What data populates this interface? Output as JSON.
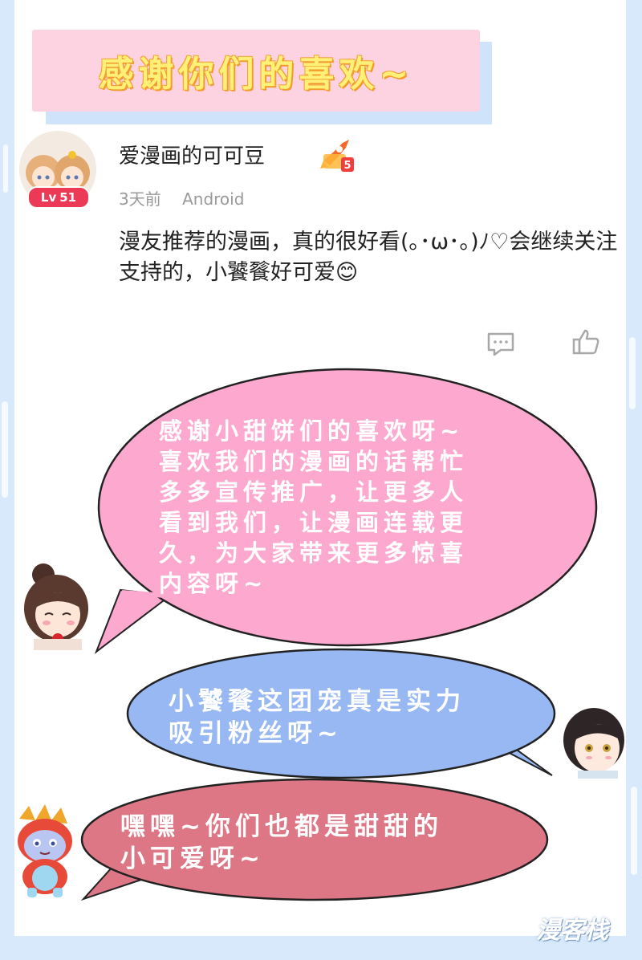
{
  "banner": {
    "text": "感谢你们的喜欢~"
  },
  "comment": {
    "username": "爱漫画的可可豆",
    "level_prefix": "Lv",
    "level": "51",
    "badge_count": "5",
    "time": "3天前",
    "device": "Android",
    "text": "漫友推荐的漫画，真的很好看(｡･ω･｡)ﾉ♡会继续关注支持的，小饕餮好可爱😊"
  },
  "bubbles": {
    "pink": [
      "感谢小甜饼们的喜欢呀~",
      "喜欢我们的漫画的话帮忙",
      "多多宣传推广，让更多人",
      "看到我们，让漫画连载更",
      "久，为大家带来更多惊喜",
      "内容呀~"
    ],
    "blue": [
      "小饕餮这团宠真是实力",
      "吸引粉丝呀~"
    ],
    "red": [
      "嘿嘿~你们也都是甜甜的",
      "小可爱呀~"
    ]
  },
  "watermark": "漫客栈",
  "colors": {
    "banner_bg": "#fdd3e2",
    "banner_text": "#fff178",
    "pink_bubble": "#fca8cf",
    "blue_bubble": "#97b8f2",
    "red_bubble": "#dd7786",
    "level_badge": "#ec3a56"
  },
  "icons": {
    "comment": "comment-icon",
    "like": "thumbs-up-icon",
    "rank": "rocket-icon"
  }
}
